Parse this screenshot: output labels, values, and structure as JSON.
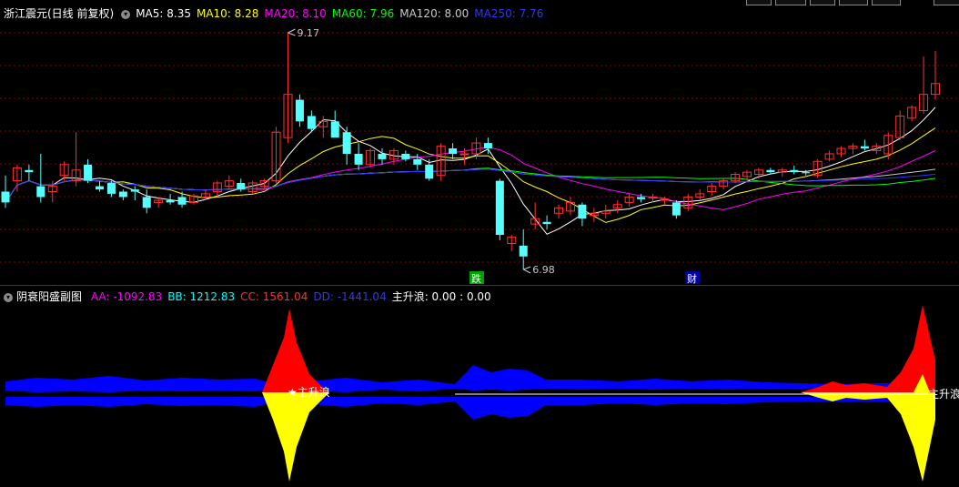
{
  "top_tabs_visible": true,
  "main_panel": {
    "title": "浙江震元(日线 前复权)",
    "ma_labels": [
      {
        "text": "MA5: 8.35",
        "color": "#ffffff"
      },
      {
        "text": "MA10: 8.28",
        "color": "#ffff00"
      },
      {
        "text": "MA20: 8.10",
        "color": "#ff00ff"
      },
      {
        "text": "MA60: 7.96",
        "color": "#00ff00"
      },
      {
        "text": "MA120: 8.00",
        "color": "#c8c8c8"
      },
      {
        "text": "MA250: 7.76",
        "color": "#3333ff"
      }
    ],
    "high_marker": "9.17",
    "low_marker": "6.98",
    "tags": [
      {
        "text": "跌",
        "bg": "#00a000"
      },
      {
        "text": "财",
        "bg": "#0000a0"
      }
    ]
  },
  "sub_panel": {
    "title": "阴衰阳盛副图",
    "values": [
      {
        "text": "AA: -1092.83",
        "color": "#ff00ff"
      },
      {
        "text": "BB: 1212.83",
        "color": "#00ffff"
      },
      {
        "text": "CC: 1561.04",
        "color": "#ff3030"
      },
      {
        "text": "DD: -1441.04",
        "color": "#3333ff"
      },
      {
        "text": "主升浪: 0.00 : 0.00",
        "color": "#ffffff"
      }
    ],
    "annotations": [
      "★主升浪",
      "主升浪"
    ]
  },
  "colors": {
    "up": "#ff3030",
    "down": "#54ffff",
    "grid": "#8b0000",
    "red_fill": "#ff0000",
    "yellow_fill": "#ffff00",
    "blue_fill": "#0000ff"
  }
}
